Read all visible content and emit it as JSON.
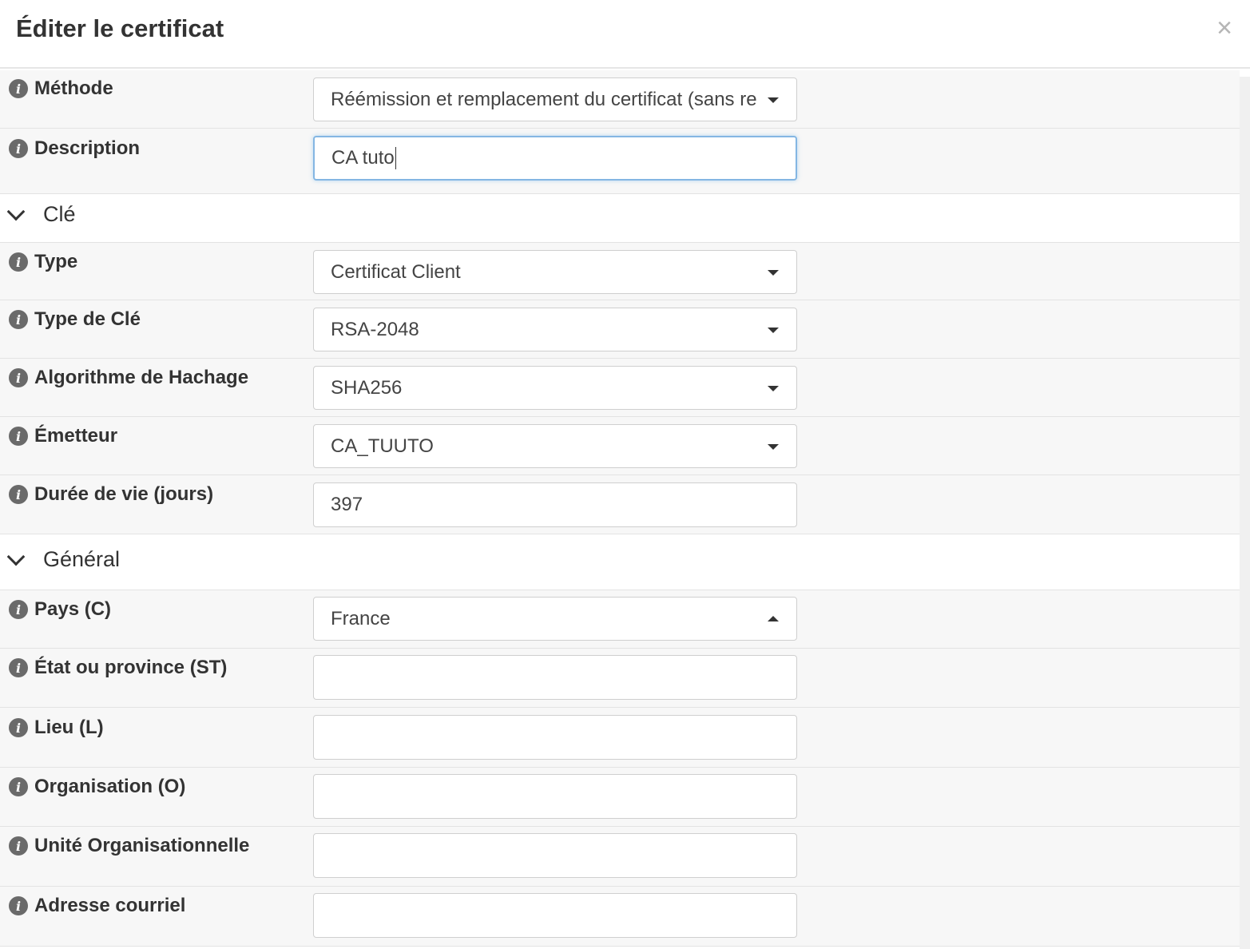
{
  "dialog": {
    "title": "Éditer le certificat",
    "close_symbol": "×"
  },
  "fields": {
    "methode": {
      "label": "Méthode",
      "value": "Réémission et remplacement du certificat (sans re"
    },
    "description": {
      "label": "Description",
      "value": "CA tuto"
    }
  },
  "sections": {
    "cle": {
      "label": "Clé"
    },
    "general": {
      "label": "Général"
    }
  },
  "cle_fields": {
    "type": {
      "label": "Type",
      "value": "Certificat Client"
    },
    "key_type": {
      "label": "Type de Clé",
      "value": "RSA-2048"
    },
    "hash": {
      "label": "Algorithme de Hachage",
      "value": "SHA256"
    },
    "issuer": {
      "label": "Émetteur",
      "value": "CA_TUUTO"
    },
    "lifetime": {
      "label": "Durée de vie (jours)",
      "value": "397"
    }
  },
  "general_fields": {
    "country": {
      "label": "Pays (C)",
      "value": "France"
    },
    "state": {
      "label": "État ou province (ST)",
      "value": ""
    },
    "locality": {
      "label": "Lieu (L)",
      "value": ""
    },
    "organization": {
      "label": "Organisation (O)",
      "value": ""
    },
    "org_unit": {
      "label": "Unité Organisationnelle",
      "value": ""
    },
    "email": {
      "label": "Adresse courriel",
      "value": ""
    }
  },
  "icons": {
    "info": "i",
    "expand": "chevron-down-icon",
    "select": "caret-down-icon"
  },
  "colors": {
    "focus_border": "#84b6e3",
    "row_bg": "#f7f7f7",
    "info_icon": "#6a6a6a"
  }
}
